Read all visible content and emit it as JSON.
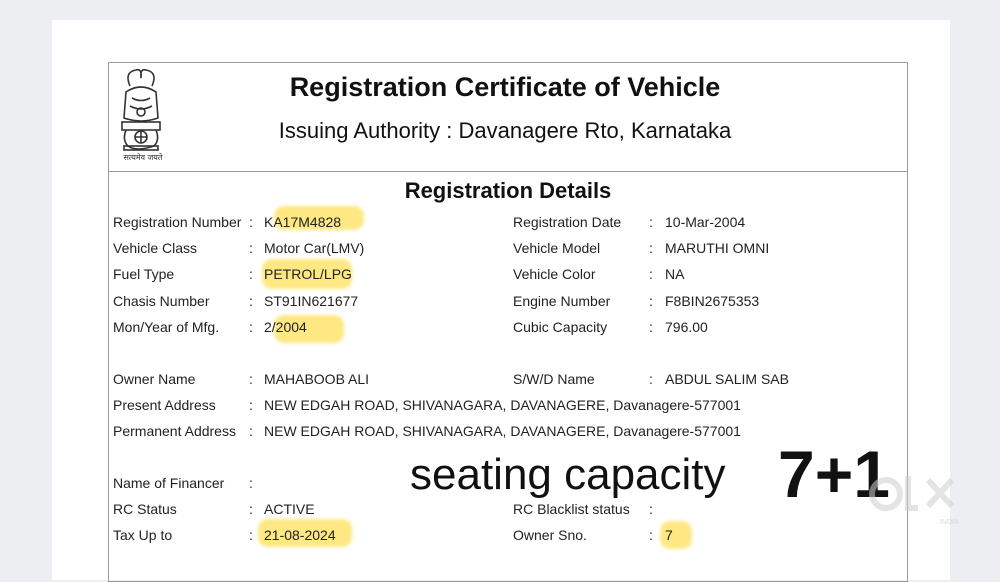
{
  "header": {
    "title": "Registration Certificate of Vehicle",
    "subtitle": "Issuing Authority : Davanagere Rto, Karnataka",
    "emblem_caption": "सत्यमेव जयते"
  },
  "section_title": "Registration Details",
  "details": {
    "registration_number": {
      "label": "Registration Number",
      "value": "KA17M4828"
    },
    "registration_date": {
      "label": "Registration Date",
      "value": "10-Mar-2004"
    },
    "vehicle_class": {
      "label": "Vehicle Class",
      "value": "Motor Car(LMV)"
    },
    "vehicle_model": {
      "label": "Vehicle Model",
      "value": "MARUTHI OMNI"
    },
    "fuel_type": {
      "label": "Fuel Type",
      "value": "PETROL/LPG"
    },
    "vehicle_color": {
      "label": "Vehicle Color",
      "value": "NA"
    },
    "chasis_number": {
      "label": "Chasis Number",
      "value": "ST91IN621677"
    },
    "engine_number": {
      "label": "Engine Number",
      "value": "F8BIN2675353"
    },
    "mfg": {
      "label": "Mon/Year of Mfg.",
      "value": "2/2004"
    },
    "cubic_capacity": {
      "label": "Cubic Capacity",
      "value": "796.00"
    },
    "owner_name": {
      "label": "Owner Name",
      "value": "MAHABOOB ALI"
    },
    "swd_name": {
      "label": "S/W/D Name",
      "value": "ABDUL SALIM SAB"
    },
    "present_address": {
      "label": "Present Address",
      "value": "NEW EDGAH ROAD, SHIVANAGARA, DAVANAGERE, Davanagere-577001"
    },
    "permanent_address": {
      "label": "Permanent Address",
      "value": "NEW EDGAH ROAD, SHIVANAGARA, DAVANAGERE, Davanagere-577001"
    },
    "financer": {
      "label": "Name of Financer",
      "value": ""
    },
    "rc_status": {
      "label": "RC Status",
      "value": "ACTIVE"
    },
    "rc_blacklist": {
      "label": "RC Blacklist status",
      "value": ""
    },
    "tax_up_to": {
      "label": "Tax Up to",
      "value": "21-08-2024"
    },
    "owner_sno": {
      "label": "Owner Sno.",
      "value": "7"
    }
  },
  "colon": ":",
  "annotation": {
    "text": "seating capacity",
    "number": "7+1"
  },
  "watermark": {
    "brand": "OLX",
    "sub": "INDIA"
  },
  "colors": {
    "highlight": "#fde15a",
    "text": "#222222",
    "border": "#9a9a9a"
  }
}
